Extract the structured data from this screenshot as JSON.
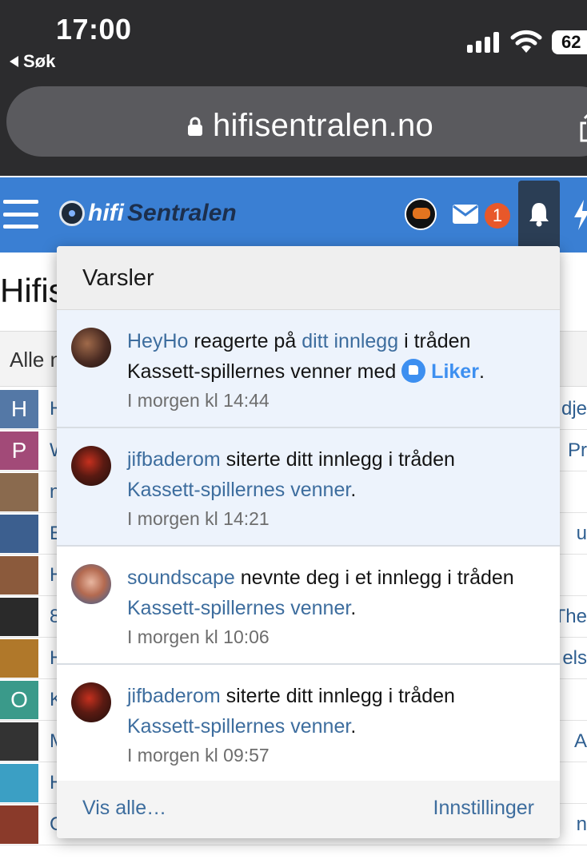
{
  "status_bar": {
    "time": "17:00",
    "back_label": "Søk",
    "battery": "62"
  },
  "browser": {
    "url": "hifisentralen.no"
  },
  "header": {
    "logo_hifi": "hifi",
    "logo_sentralen": "Sentralen",
    "mail_badge": "1"
  },
  "page": {
    "title": "Hifis",
    "filter_label": "Alle n",
    "rows": [
      {
        "avatar_letter": "H",
        "avatar_color": "#5478a6",
        "text": "H",
        "right": "dje"
      },
      {
        "avatar_letter": "P",
        "avatar_color": "#a24a78",
        "text": "W",
        "right": "Pr"
      },
      {
        "avatar_letter": "",
        "avatar_color": "#8a6a4e",
        "text": "n",
        "right": ""
      },
      {
        "avatar_letter": "",
        "avatar_color": "#3c5f8f",
        "text": "E",
        "right": "u"
      },
      {
        "avatar_letter": "",
        "avatar_color": "#8b5a3c",
        "text": "H",
        "right": ""
      },
      {
        "avatar_letter": "",
        "avatar_color": "#2a2a2a",
        "text": "8",
        "right": "The"
      },
      {
        "avatar_letter": "",
        "avatar_color": "#b0782a",
        "text": "H",
        "right": "els"
      },
      {
        "avatar_letter": "O",
        "avatar_color": "#3a9a8a",
        "text": "K",
        "right": ""
      },
      {
        "avatar_letter": "",
        "avatar_color": "#333333",
        "text": "M",
        "right": "A"
      },
      {
        "avatar_letter": "",
        "avatar_color": "#3b9fc4",
        "text": "H",
        "right": ""
      },
      {
        "avatar_letter": "",
        "avatar_color": "#8a3a2a",
        "text": "C",
        "right": "n"
      }
    ]
  },
  "notifications": {
    "heading": "Varsler",
    "items": [
      {
        "user": "HeyHo",
        "action": " reagerte på ",
        "link": "ditt innlegg",
        "mid": " i tråden",
        "thread": "Kassett-spillernes venner med ",
        "reaction": "Liker",
        "end": ".",
        "time": "I morgen kl 14:44"
      },
      {
        "user": "jifbaderom",
        "action": " siterte ditt innlegg i tråden",
        "thread": "Kassett-spillernes venner",
        "end": ".",
        "time": "I morgen kl 14:21"
      },
      {
        "user": "soundscape",
        "action": " nevnte deg i et innlegg i tråden",
        "thread": "Kassett-spillernes venner",
        "end": ".",
        "time": "I morgen kl 10:06"
      },
      {
        "user": "jifbaderom",
        "action": " siterte ditt innlegg i tråden",
        "thread": "Kassett-spillernes venner",
        "end": ".",
        "time": "I morgen kl 09:57"
      }
    ],
    "footer": {
      "show_all": "Vis alle…",
      "settings": "Innstillinger"
    }
  }
}
